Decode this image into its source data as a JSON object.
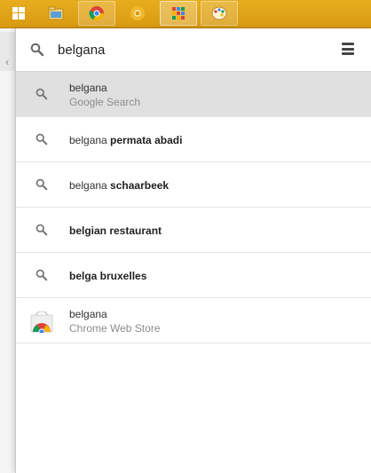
{
  "taskbar": {
    "items": [
      {
        "name": "start-button-icon"
      },
      {
        "name": "file-explorer-icon"
      },
      {
        "name": "chrome-icon"
      },
      {
        "name": "chrome-canary-icon"
      },
      {
        "name": "app-launcher-icon"
      },
      {
        "name": "paint-icon"
      }
    ],
    "color": "#e0a318"
  },
  "launcher": {
    "search": {
      "value": "belgana"
    },
    "results": [
      {
        "type": "two-line",
        "title": "belgana",
        "subtitle": "Google Search",
        "selected": true
      },
      {
        "type": "single",
        "prefix": "belgana ",
        "bold": "permata abadi"
      },
      {
        "type": "single",
        "prefix": "belgana ",
        "bold": "schaarbeek"
      },
      {
        "type": "single",
        "prefix": "",
        "bold": "belgian restaurant"
      },
      {
        "type": "single",
        "prefix": "",
        "bold": "belga bruxelles"
      },
      {
        "type": "two-line",
        "title": "belgana",
        "subtitle": "Chrome Web Store",
        "selected": false
      }
    ]
  }
}
